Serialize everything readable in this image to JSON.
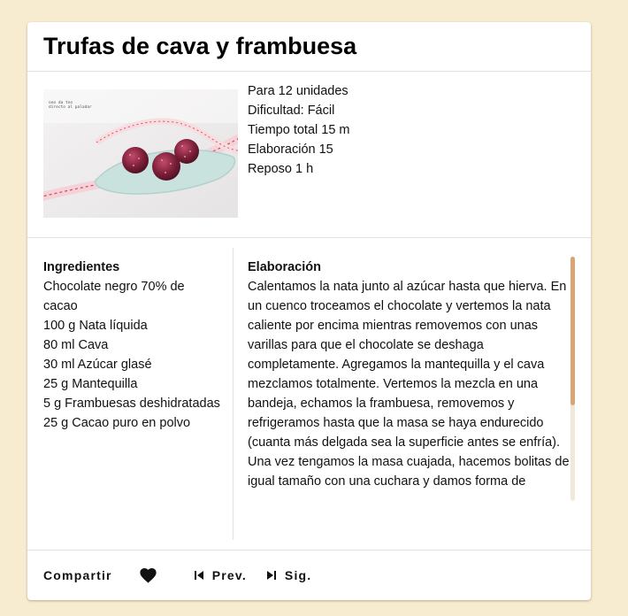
{
  "recipe": {
    "title": "Trufas de cava y frambuesa",
    "photo_alt": "trufas-photo",
    "photo_caption": "made with love",
    "meta": [
      "Para 12 unidades",
      "Dificultad: Fácil",
      "Tiempo total 15 m",
      "Elaboración 15",
      "Reposo 1 h"
    ],
    "ingredients": {
      "heading": "Ingredientes",
      "items": [
        "Chocolate negro 70% de cacao",
        "100 g Nata líquida",
        "80 ml Cava",
        "30 ml Azúcar glasé",
        "25 g Mantequilla",
        "5 g Frambuesas deshidratadas",
        "25 g Cacao puro en polvo"
      ]
    },
    "elaboration": {
      "heading": "Elaboración",
      "text": "Calentamos la nata junto al azúcar hasta que hierva. En un cuenco troceamos el chocolate y vertemos la nata caliente por encima mientras removemos con unas varillas para que el chocolate se deshaga completamente. Agregamos la mantequilla y el cava mezclamos totalmente. Vertemos la mezcla en una bandeja, echamos la frambuesa, removemos y refrigeramos hasta que la masa se haya endurecido (cuanta más delgada sea la superficie antes se enfría). Una vez tengamos la masa cuajada, hacemos bolitas de igual tamaño con una cuchara y damos forma de"
    }
  },
  "footer": {
    "share_label": "Compartir",
    "favorite_icon": "heart-icon",
    "prev_label": "Prev.",
    "prev_icon": "skip-previous-icon",
    "next_label": "Sig.",
    "next_icon": "skip-next-icon"
  },
  "colors": {
    "page_background": "#f8ecd0",
    "card_background": "#ffffff",
    "scroll_thumb": "#d9a574",
    "scroll_track": "#f1e8dc",
    "divider": "#e2e2e2"
  },
  "scroll": {
    "position_fraction": 0.0,
    "visible_fraction": 0.61
  }
}
